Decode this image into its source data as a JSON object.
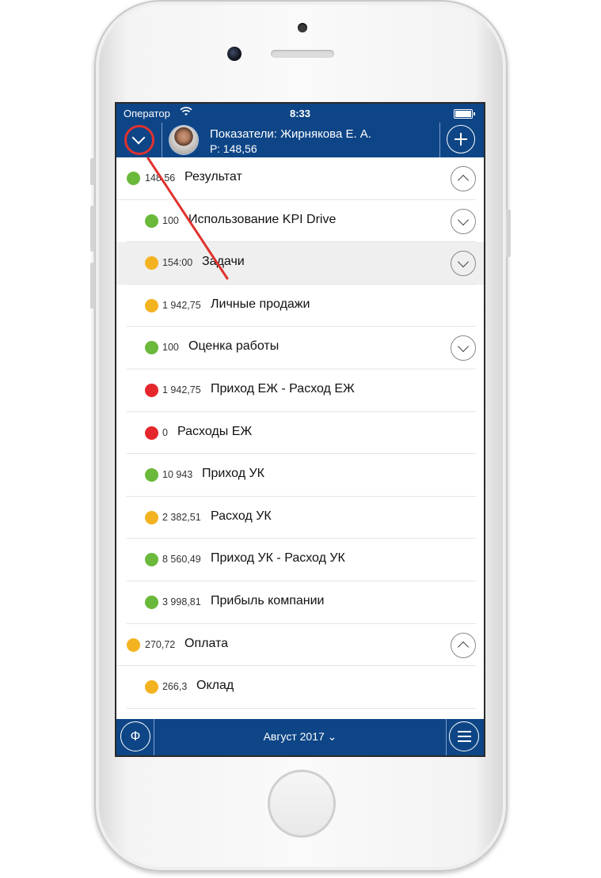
{
  "status_bar": {
    "carrier": "Оператор",
    "time": "8:33"
  },
  "header": {
    "title": "Показатели: Жирнякова Е. А.",
    "subtitle": "Р: 148,56"
  },
  "rows": [
    {
      "value": "148,56",
      "label": "Результат",
      "status": "green",
      "level": 0,
      "toggle": "up",
      "highlight": false
    },
    {
      "value": "100",
      "label": "Использование KPI Drive",
      "status": "green",
      "level": 1,
      "toggle": "down",
      "highlight": false
    },
    {
      "value": "154:00",
      "label": "Задачи",
      "status": "yellow",
      "level": 1,
      "toggle": "down",
      "highlight": true
    },
    {
      "value": "1 942,75",
      "label": "Личные продажи",
      "status": "yellow",
      "level": 1,
      "toggle": null,
      "highlight": false
    },
    {
      "value": "100",
      "label": "Оценка работы",
      "status": "green",
      "level": 1,
      "toggle": "down",
      "highlight": false
    },
    {
      "value": "1 942,75",
      "label": "Приход ЕЖ - Расход ЕЖ",
      "status": "red",
      "level": 1,
      "toggle": null,
      "highlight": false
    },
    {
      "value": "0",
      "label": "Расходы ЕЖ",
      "status": "red",
      "level": 1,
      "toggle": null,
      "highlight": false
    },
    {
      "value": "10 943",
      "label": "Приход УК",
      "status": "green",
      "level": 1,
      "toggle": null,
      "highlight": false
    },
    {
      "value": "2 382,51",
      "label": "Расход УК",
      "status": "yellow",
      "level": 1,
      "toggle": null,
      "highlight": false
    },
    {
      "value": "8 560,49",
      "label": "Приход УК - Расход УК",
      "status": "green",
      "level": 1,
      "toggle": null,
      "highlight": false
    },
    {
      "value": "3 998,81",
      "label": "Прибыль компании",
      "status": "green",
      "level": 1,
      "toggle": null,
      "highlight": false
    },
    {
      "value": "270,72",
      "label": "Оплата",
      "status": "yellow",
      "level": 0,
      "toggle": "up",
      "highlight": false
    },
    {
      "value": "266,3",
      "label": "Оклад",
      "status": "yellow",
      "level": 1,
      "toggle": null,
      "highlight": false
    }
  ],
  "footer": {
    "left_glyph": "Ф",
    "month_label": "Август 2017 ⌄"
  },
  "icons": {
    "collapse": "chevron-down-icon",
    "add": "plus-icon",
    "menu": "hamburger-menu-icon",
    "wifi": "wifi-icon",
    "battery": "battery-icon",
    "status_dot": "status-dot-icon"
  },
  "colors": {
    "bar_blue": "#0e4586",
    "green": "#6ab93b",
    "yellow": "#f3b320",
    "red": "#e5272c",
    "annotation_red": "#e0322e"
  }
}
